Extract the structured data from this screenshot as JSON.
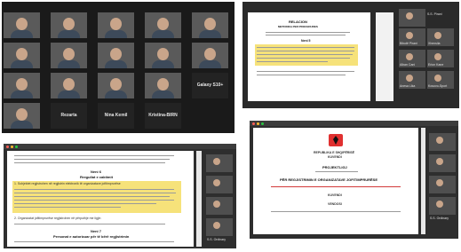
{
  "panel1": {
    "participants": [
      {
        "name": "Rezarta"
      },
      {
        "name": "Nina Kemil"
      },
      {
        "name": "Kristina-BIRN"
      },
      {
        "name": "Galaxy S10+"
      }
    ]
  },
  "panel2": {
    "doc_heading_1": "RELACION",
    "doc_heading_2": "METODIKA PER PROCEDURES",
    "section_label": "Neni 5",
    "side_participants": [
      {
        "name": "Xhensila"
      },
      {
        "name": "Bibotë Pirani"
      },
      {
        "name": "Anesa Lika"
      },
      {
        "name": "S.S. Pirani"
      },
      {
        "name": "Alban Cani"
      },
      {
        "name": "Erion Kane"
      },
      {
        "name": "Kosovo-Sport"
      },
      {
        "name": "Liman"
      },
      {
        "name": "Kosova"
      },
      {
        "name": "Arian"
      }
    ]
  },
  "panel3": {
    "section_a": "Neni 6",
    "section_a_title": "Rregullat e caktimit",
    "section_b": "Neni 7",
    "section_b_title": "Personat e autorizuar për të bërë regjistrimin",
    "item_1": "1. Subjektet regjistrohen në regjistrin elektronik të organizatave jofitimprurëse",
    "item_2": "2. Organizatat jofitimprurëse regjistrohen në përputhje me ligjin",
    "side_participants": [
      {
        "name": ""
      },
      {
        "name": ""
      },
      {
        "name": ""
      },
      {
        "name": "S.S. Ordinary"
      }
    ]
  },
  "panel4": {
    "republic": "REPUBLIKA E SHQIPËRISË",
    "institution": "KUVENDI",
    "draft": "PROJEKTLIGJ",
    "law_title": "PËR REGJISTRIMIN E ORGANIZATAVE JOFITIMPRURËSE",
    "kuvendi": "KUVENDI",
    "vendosi": "VENDOSI",
    "side_participants": [
      {
        "name": ""
      },
      {
        "name": ""
      },
      {
        "name": ""
      },
      {
        "name": "S.S. Ordinary"
      }
    ]
  },
  "colors": {
    "highlight": "#f6e27a",
    "flag_red": "#e03030",
    "mac_red": "#ff5f57",
    "mac_yellow": "#febc2e",
    "mac_green": "#28c840"
  }
}
